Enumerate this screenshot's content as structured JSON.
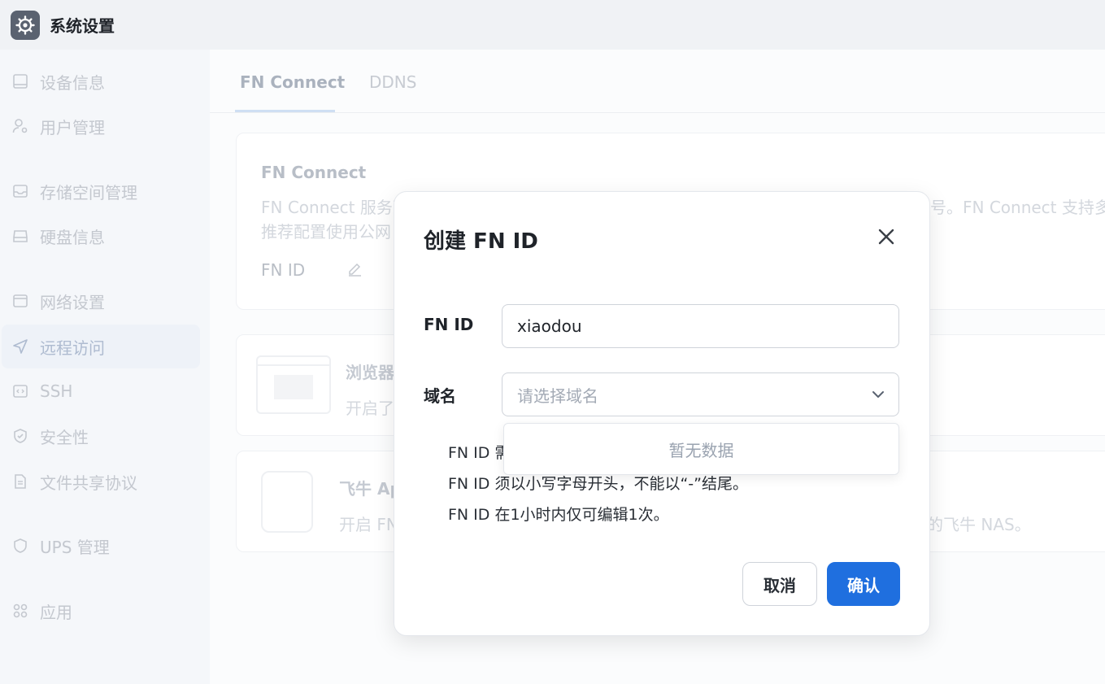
{
  "app": {
    "title": "系统设置",
    "icon": "gear-icon"
  },
  "sidebar": {
    "items": [
      {
        "label": "设备信息",
        "icon": "monitor-icon"
      },
      {
        "label": "用户管理",
        "icon": "user-gear-icon"
      },
      {
        "label": "存储空间管理",
        "icon": "inbox-icon"
      },
      {
        "label": "硬盘信息",
        "icon": "hard-drive-icon"
      },
      {
        "label": "网络设置",
        "icon": "window-icon"
      },
      {
        "label": "远程访问",
        "icon": "send-icon",
        "active": true
      },
      {
        "label": "SSH",
        "icon": "code-icon"
      },
      {
        "label": "安全性",
        "icon": "shield-check-icon"
      },
      {
        "label": "文件共享协议",
        "icon": "document-icon"
      },
      {
        "label": "UPS 管理",
        "icon": "shield-icon"
      },
      {
        "label": "应用",
        "icon": "apps-grid-icon"
      }
    ]
  },
  "tabs": [
    {
      "label": "FN Connect",
      "active": true
    },
    {
      "label": "DDNS",
      "active": false
    }
  ],
  "fn_card": {
    "title": "FN Connect",
    "desc_line1": "FN Connect 服务可",
    "desc_line1_tail": "号。FN Connect 支持多种",
    "desc_line2": "推荐配置使用公网",
    "id_label": "FN ID"
  },
  "browser_card": {
    "title": "浏览器",
    "desc": "开启了"
  },
  "app_card": {
    "title": "飞牛 Ap",
    "desc": "开启 FN",
    "desc_tail": "的飞牛 NAS。"
  },
  "modal": {
    "title": "创建 FN ID",
    "fn_id_label": "FN ID",
    "fn_id_value": "xiaodou",
    "domain_label": "域名",
    "domain_placeholder": "请选择域名",
    "dropdown_empty": "暂无数据",
    "hints": [
      "FN ID 需",
      "FN ID 须以小写字母开头，不能以“-”结尾。",
      "FN ID 在1小时内仅可编辑1次。"
    ],
    "cancel_label": "取消",
    "confirm_label": "确认"
  },
  "colors": {
    "primary": "#1f6fdf"
  }
}
